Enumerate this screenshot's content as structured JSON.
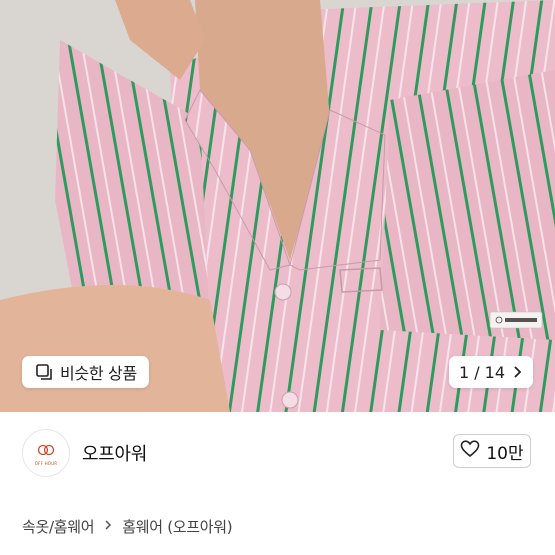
{
  "product_image": {
    "alt": "",
    "colors": {
      "shirt": "#ecbccb",
      "stripe": "#2f9a5e",
      "skin": "#d9a98e",
      "background": "#d9d6d2"
    }
  },
  "overlay": {
    "similar_products_label": "비슷한 상품",
    "similar_icon": "similar-items-icon",
    "page_indicator": "1 / 14",
    "next_icon": "chevron-right-icon"
  },
  "seller": {
    "name": "오프아워",
    "avatar_text": "OFF HOUR",
    "avatar_color": "#d04a2a"
  },
  "like": {
    "icon": "heart-outline-icon",
    "count": "10만"
  },
  "breadcrumb": {
    "items": [
      "속옷/홈웨어",
      "홈웨어 (오프아워)"
    ],
    "separator_icon": "chevron-right-icon"
  }
}
